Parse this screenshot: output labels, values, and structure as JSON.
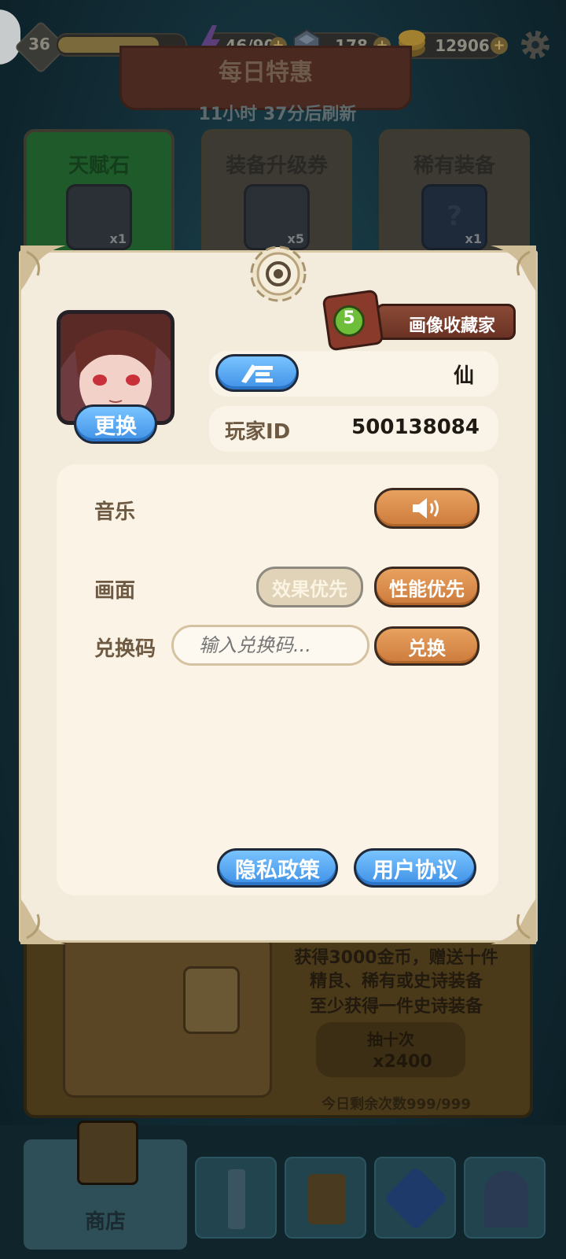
{
  "top_bar": {
    "level": "36",
    "energy": "46/90",
    "gems": "178",
    "coins": "12906",
    "plus": "+"
  },
  "shop_bg": {
    "banner_title": "每日特惠",
    "refresh_text": "11小时 37分后刷新",
    "cards": [
      {
        "title": "天赋石",
        "qty": "x1"
      },
      {
        "title": "装备升级券",
        "qty": "x5"
      },
      {
        "title": "稀有装备",
        "qty": "x1"
      }
    ],
    "chest_desc": [
      "获得3000金币，赠送十件",
      "精良、稀有或史诗装备",
      "至少获得一件史诗装备"
    ],
    "draw_label": "抽十次",
    "draw_cost": "x2400",
    "remaining": "今日剩余次数999/999",
    "nav_shop": "商店"
  },
  "settings": {
    "badge_level": "5",
    "badge_title": "画像收藏家",
    "change_avatar": "更换",
    "player_name": "仙",
    "player_id_label": "玩家ID",
    "player_id": "500138084",
    "music_label": "音乐",
    "graphics_label": "画面",
    "graphics_options": [
      "效果优先",
      "性能优先"
    ],
    "redeem_label": "兑换码",
    "redeem_placeholder": "输入兑换码...",
    "redeem_button": "兑换",
    "privacy_button": "隐私政策",
    "agreement_button": "用户协议"
  },
  "colors": {
    "accent_orange": "#d98a4a",
    "accent_blue": "#4fa2f0",
    "panel_bg": "#f3ecdc"
  }
}
